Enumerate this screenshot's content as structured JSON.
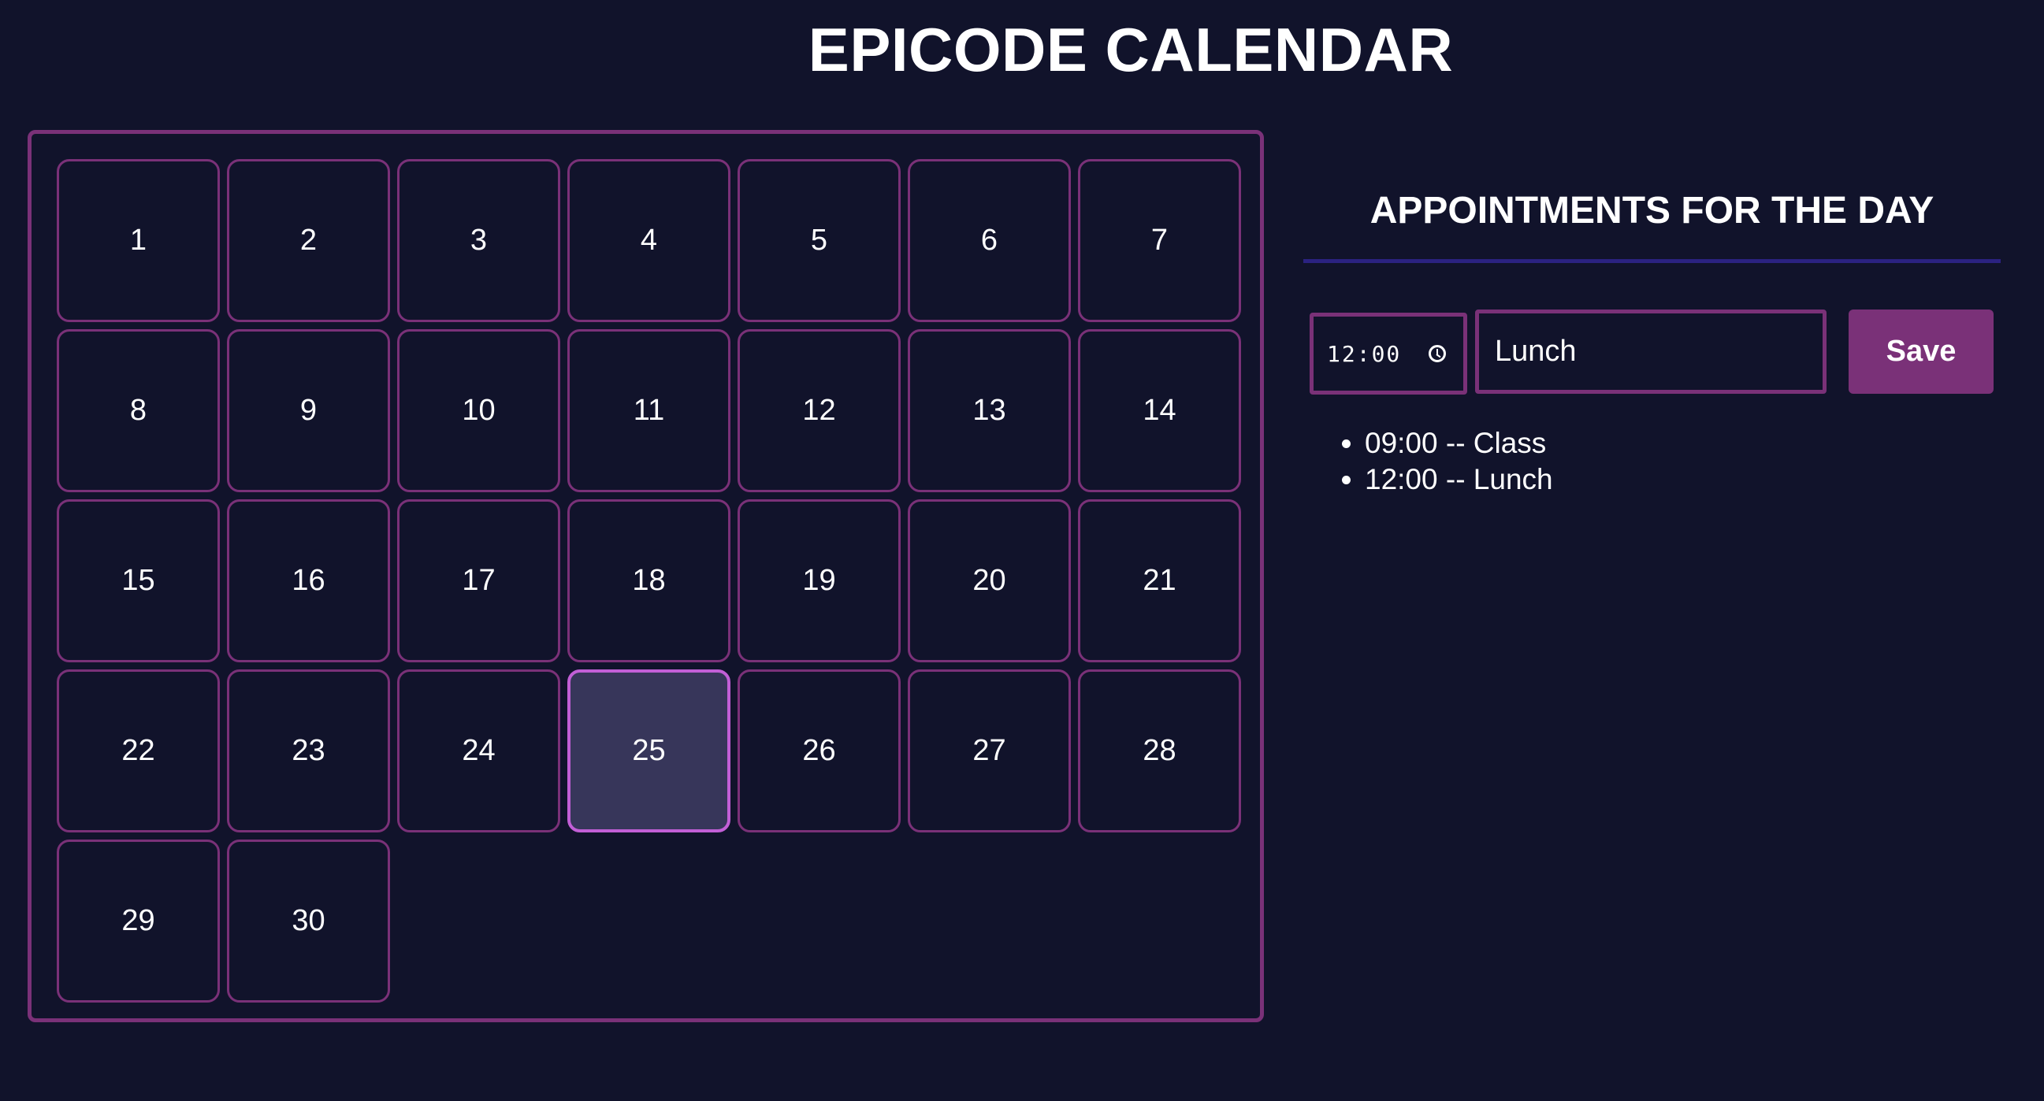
{
  "header": {
    "title": "EPICODE CALENDAR"
  },
  "calendar": {
    "days": [
      "1",
      "2",
      "3",
      "4",
      "5",
      "6",
      "7",
      "8",
      "9",
      "10",
      "11",
      "12",
      "13",
      "14",
      "15",
      "16",
      "17",
      "18",
      "19",
      "20",
      "21",
      "22",
      "23",
      "24",
      "25",
      "26",
      "27",
      "28",
      "29",
      "30"
    ],
    "selected_day": "25"
  },
  "appointments_panel": {
    "heading": "APPOINTMENTS FOR THE DAY",
    "time_value": "12:00",
    "description_value": "Lunch",
    "save_label": "Save",
    "items": [
      "09:00 -- Class",
      "12:00 -- Lunch"
    ]
  },
  "colors": {
    "background": "#11132b",
    "accent": "#7a3178",
    "selected_fill": "#37365a",
    "selected_border": "#c25fd6",
    "divider": "#2b2281"
  }
}
